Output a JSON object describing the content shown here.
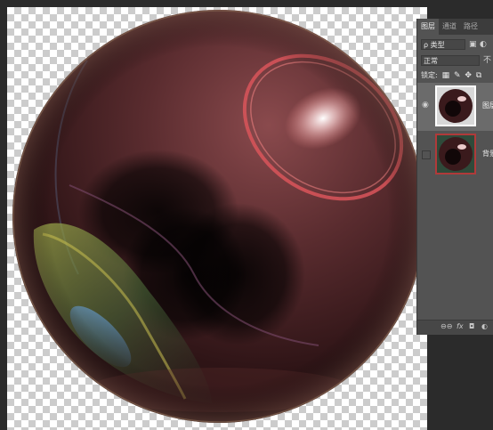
{
  "panel": {
    "tabs": [
      {
        "label": "图层"
      },
      {
        "label": "通道"
      },
      {
        "label": "路径"
      }
    ],
    "filter_label": "ρ 类型",
    "blend_mode": "正常",
    "opacity_label": "不",
    "lock_label": "锁定:",
    "layers": [
      {
        "name": "图层",
        "visible": true,
        "selected": true
      },
      {
        "name": "背景",
        "visible": false,
        "selected": false
      }
    ],
    "bottom_icons": [
      "link-icon",
      "fx-icon",
      "mask-icon",
      "adjustment-icon"
    ],
    "bottom_labels": {
      "link": "⊖⊖",
      "fx": "fx",
      "mask": "◘",
      "adjust": "◐"
    }
  },
  "colors": {
    "sphere_base": "#3a1a1c",
    "highlight_ring": "#d9555a",
    "panel_bg": "#535353",
    "selection_border": "#b03a3a"
  }
}
